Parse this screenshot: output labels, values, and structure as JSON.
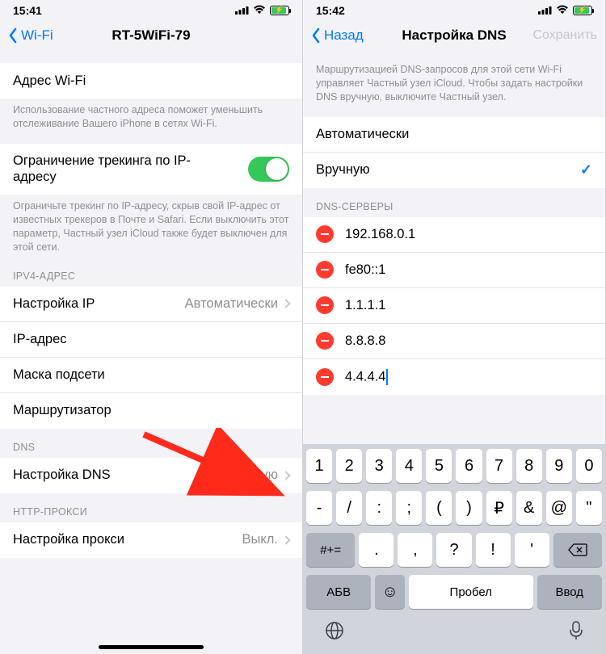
{
  "left": {
    "status": {
      "time": "15:41"
    },
    "nav": {
      "back": "Wi-Fi",
      "title": "RT-5WiFi-79"
    },
    "wifi_addr_label": "Адрес Wi-Fi",
    "wifi_addr_hint": "Использование частного адреса поможет уменьшить отслеживание Вашего iPhone в сетях Wi-Fi.",
    "tracking_label": "Ограничение трекинга по IP-адресу",
    "tracking_hint": "Ограничьте трекинг по IP-адресу, скрыв свой IP-адрес от известных трекеров в Почте и Safari. Если выключить этот параметр, Частный узел iCloud также будет выключен для этой сети.",
    "ipv4_header": "IPV4-АДРЕС",
    "ipv4": {
      "config_label": "Настройка IP",
      "config_value": "Автоматически",
      "ip_label": "IP-адрес",
      "mask_label": "Маска подсети",
      "router_label": "Маршрутизатор"
    },
    "dns_header": "DNS",
    "dns_label": "Настройка DNS",
    "dns_value": "Вручную",
    "proxy_header": "HTTP-ПРОКСИ",
    "proxy_label": "Настройка прокси",
    "proxy_value": "Выкл."
  },
  "right": {
    "status": {
      "time": "15:42"
    },
    "nav": {
      "back": "Назад",
      "title": "Настройка DNS",
      "action": "Сохранить"
    },
    "hint": "Маршрутизацией DNS-запросов для этой сети Wi-Fi управляет Частный узел iCloud. Чтобы задать настройки DNS вручную, выключите Частный узел.",
    "mode": {
      "auto": "Автоматически",
      "manual": "Вручную"
    },
    "dns_header": "DNS-СЕРВЕРЫ",
    "servers": [
      "192.168.0.1",
      "fe80::1",
      "1.1.1.1",
      "8.8.8.8",
      "4.4.4.4"
    ],
    "keyboard": {
      "row1": [
        "1",
        "2",
        "3",
        "4",
        "5",
        "6",
        "7",
        "8",
        "9",
        "0"
      ],
      "row2": [
        "-",
        "/",
        ":",
        ";",
        "(",
        ")",
        "₽",
        "&",
        "@",
        "\""
      ],
      "row3_mode": "#+=",
      "row3": [
        ".",
        ",",
        "?",
        "!",
        "'"
      ],
      "abc": "АБВ",
      "space": "Пробел",
      "enter": "Ввод"
    }
  }
}
